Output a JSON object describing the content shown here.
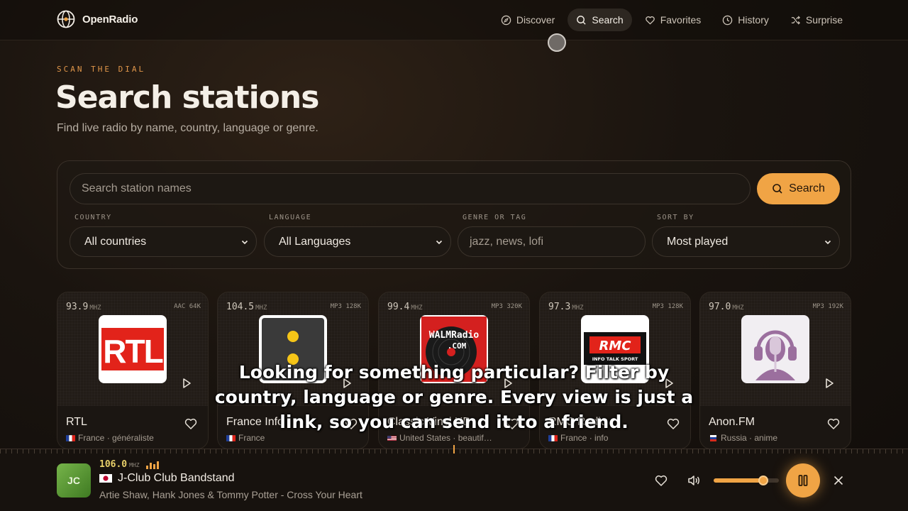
{
  "brand": {
    "name": "OpenRadio"
  },
  "nav": [
    {
      "label": "Discover",
      "icon": "compass-icon"
    },
    {
      "label": "Search",
      "icon": "search-icon",
      "active": true
    },
    {
      "label": "Favorites",
      "icon": "heart-icon"
    },
    {
      "label": "History",
      "icon": "clock-icon"
    },
    {
      "label": "Surprise",
      "icon": "shuffle-icon"
    }
  ],
  "hero": {
    "eyebrow": "SCAN THE DIAL",
    "title": "Search stations",
    "subtitle": "Find live radio by name, country, language or genre."
  },
  "search": {
    "placeholder": "Search station names",
    "button_label": "Search",
    "filters": {
      "country": {
        "label": "COUNTRY",
        "value": "All countries"
      },
      "language": {
        "label": "LANGUAGE",
        "value": "All Languages"
      },
      "genre": {
        "label": "GENRE OR TAG",
        "placeholder": "jazz, news, lofi"
      },
      "sort": {
        "label": "SORT BY",
        "value": "Most played"
      }
    }
  },
  "stations": [
    {
      "freq": "93.9",
      "unit": "MHZ",
      "codec": "AAC 64K",
      "name": "RTL",
      "country": "France",
      "tag": "généraliste",
      "meta_sep": " · "
    },
    {
      "freq": "104.5",
      "unit": "MHZ",
      "codec": "MP3 128K",
      "name": "France Info",
      "country": "France",
      "tag": "",
      "meta_sep": ""
    },
    {
      "freq": "99.4",
      "unit": "MHZ",
      "codec": "MP3 320K",
      "name": "Classic Vinyl HD",
      "country": "United States",
      "tag": "beautif…",
      "meta_sep": " · "
    },
    {
      "freq": "97.3",
      "unit": "MHZ",
      "codec": "MP3 128K",
      "name": "RMC Radio",
      "country": "France",
      "tag": "info",
      "meta_sep": " · "
    },
    {
      "freq": "97.0",
      "unit": "MHZ",
      "codec": "MP3 192K",
      "name": "Anon.FM",
      "country": "Russia",
      "tag": "anime",
      "meta_sep": " · "
    }
  ],
  "logos": {
    "rtl": "RTL",
    "walm_top": "WALMRadio",
    "walm_bottom": ".COM",
    "rmc_top": "RMC",
    "rmc_bottom": "INFO TALK SPORT"
  },
  "caption": "Looking for something particular? Filter by country, language or genre. Every view is just a link, so you can send it to a friend.",
  "player": {
    "art_initials": "JC",
    "freq": "106.0",
    "unit": "MHZ",
    "title": "J-Club Club Bandstand",
    "track": "Artie Shaw, Hank Jones & Tommy Potter - Cross Your Heart",
    "volume": 0.76
  },
  "colors": {
    "accent": "#f0a445",
    "background": "#1a140f"
  }
}
